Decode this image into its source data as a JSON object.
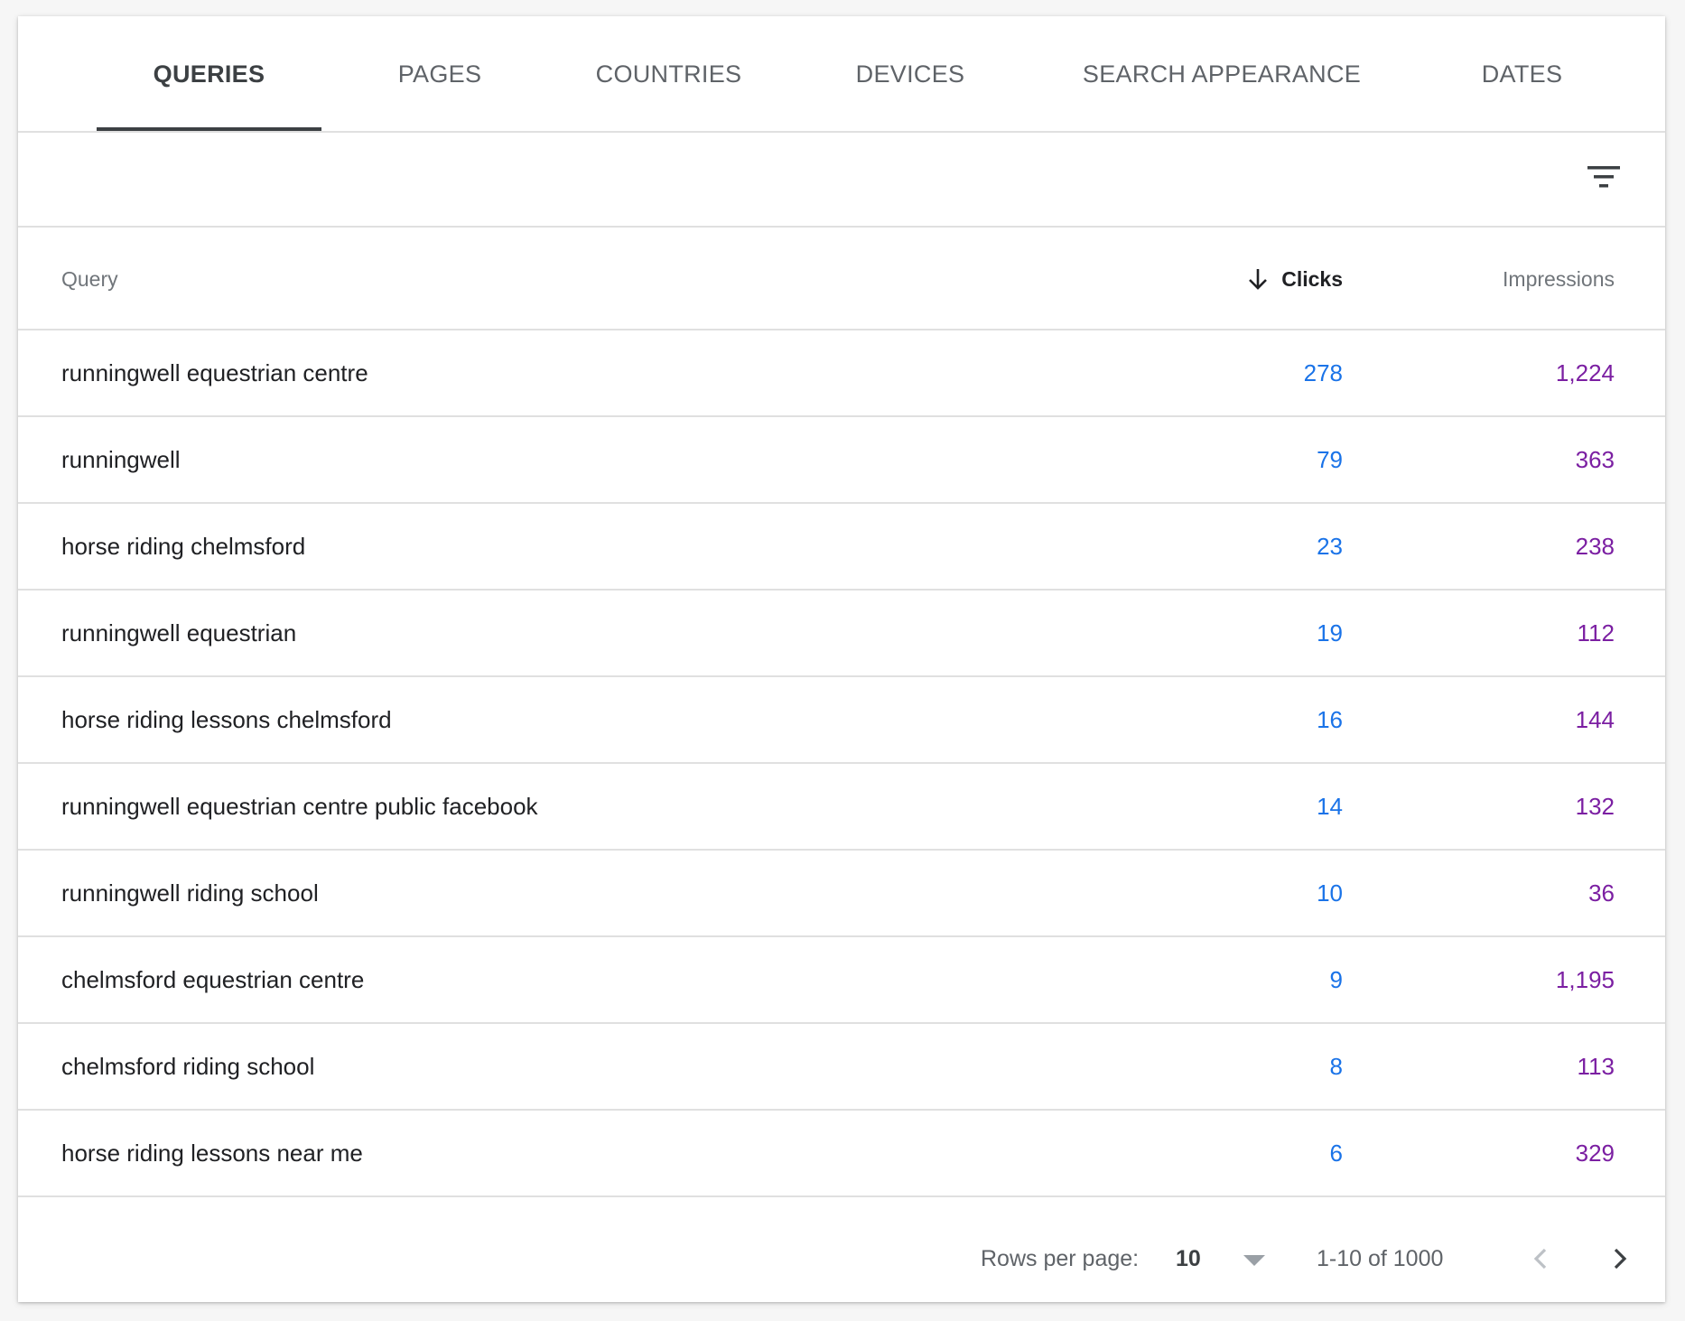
{
  "tabs": [
    {
      "label": "QUERIES",
      "active": true
    },
    {
      "label": "PAGES",
      "active": false
    },
    {
      "label": "COUNTRIES",
      "active": false
    },
    {
      "label": "DEVICES",
      "active": false
    },
    {
      "label": "SEARCH APPEARANCE",
      "active": false
    },
    {
      "label": "DATES",
      "active": false
    }
  ],
  "toolbar": {
    "filter_icon": "filter-list-icon"
  },
  "table": {
    "headers": {
      "query": "Query",
      "clicks": "Clicks",
      "impressions": "Impressions"
    },
    "sort": {
      "column": "clicks",
      "direction": "descending",
      "icon": "arrow-downward-icon"
    },
    "rows": [
      {
        "query": "runningwell equestrian centre",
        "clicks": "278",
        "impressions": "1,224"
      },
      {
        "query": "runningwell",
        "clicks": "79",
        "impressions": "363"
      },
      {
        "query": "horse riding chelmsford",
        "clicks": "23",
        "impressions": "238"
      },
      {
        "query": "runningwell equestrian",
        "clicks": "19",
        "impressions": "112"
      },
      {
        "query": "horse riding lessons chelmsford",
        "clicks": "16",
        "impressions": "144"
      },
      {
        "query": "runningwell equestrian centre public facebook",
        "clicks": "14",
        "impressions": "132"
      },
      {
        "query": "runningwell riding school",
        "clicks": "10",
        "impressions": "36"
      },
      {
        "query": "chelmsford equestrian centre",
        "clicks": "9",
        "impressions": "1,195"
      },
      {
        "query": "chelmsford riding school",
        "clicks": "8",
        "impressions": "113"
      },
      {
        "query": "horse riding lessons near me",
        "clicks": "6",
        "impressions": "329"
      }
    ]
  },
  "pagination": {
    "rows_per_page_label": "Rows per page:",
    "rows_per_page_value": "10",
    "range_label": "1-10 of 1000",
    "prev_icon": "chevron-left-icon",
    "next_icon": "chevron-right-icon"
  },
  "colors": {
    "clicks": "#1a73e8",
    "impressions": "#7b1fa2",
    "active_tab": "#3c4043"
  }
}
